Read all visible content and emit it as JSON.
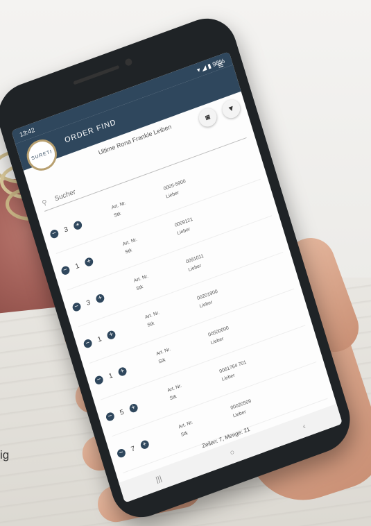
{
  "status": {
    "left": "13:42",
    "right": "▾ ◢ ▮ 98%"
  },
  "app": {
    "logo_text": "SURETI",
    "title": "ORDER FIND",
    "subtitle": "Ultime Rona Frankle Leiben"
  },
  "search": {
    "placeholder": "Sucher"
  },
  "rows": [
    {
      "qty": "3",
      "label1": "Art. Nr.",
      "label2": "Stk",
      "code": "0005-5900",
      "name": "Lieber"
    },
    {
      "qty": "1",
      "label1": "Art. Nr.",
      "label2": "Stk",
      "code": "0009121",
      "name": "Lieber"
    },
    {
      "qty": "3",
      "label1": "Art. Nr.",
      "label2": "Stk",
      "code": "0091011",
      "name": "Lieber"
    },
    {
      "qty": "1",
      "label1": "Art. Nr.",
      "label2": "Stk",
      "code": "00201900",
      "name": "Lieber"
    },
    {
      "qty": "1",
      "label1": "Art. Nr.",
      "label2": "Stk",
      "code": "00500000",
      "name": "Lieber"
    },
    {
      "qty": "5",
      "label1": "Art. Nr.",
      "label2": "Stk",
      "code": "0061764 701",
      "name": "Lieber"
    },
    {
      "qty": "7",
      "label1": "Art. Nr.",
      "label2": "Stk",
      "code": "00020509",
      "name": "Lieber"
    }
  ],
  "footer": {
    "summary": "Zeilen: 7, Menge: 21"
  },
  "background": {
    "side_text": "ig"
  },
  "colors": {
    "appbar": "#2f475d",
    "accent": "#2f475d",
    "cloth": "#9e5c55"
  },
  "icons": {
    "menu": "hamburger-icon",
    "camera": "camera-icon",
    "filter": "filter-icon",
    "search": "search-icon"
  }
}
